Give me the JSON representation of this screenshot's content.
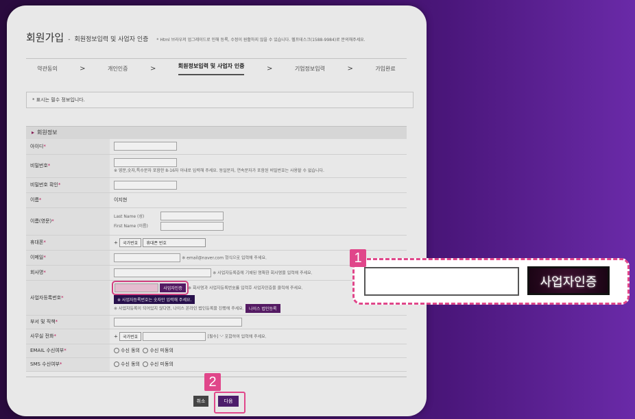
{
  "header": {
    "title": "회원가입",
    "dash": "-",
    "subtitle": "회원정보입력 및 사업자 인증",
    "note": "* Html 브라우저 업그레이드로 인해 등록, 수정이 원활하지 않을 수 있습니다. 헬프데스크(1588-9984)로 문의해주세요."
  },
  "steps": [
    {
      "label": "약관동의"
    },
    {
      "label": "개인인증"
    },
    {
      "label": "회원정보입력 및 사업자 인증"
    },
    {
      "label": "기업정보입력"
    },
    {
      "label": "가입완료"
    }
  ],
  "chevron": ">",
  "required_note": "* 표시는 필수 정보입니다.",
  "section_title": "회원정보",
  "fields": {
    "id": "아이디",
    "password": "비밀번호",
    "password_hint": "※ 영문,숫자,특수문자 포함한 8-16자 이내로 입력해 주세요. 동일문자, 연속문자가 포함된 비밀번호는 사용할 수 없습니다.",
    "password_confirm": "비밀번호 확인",
    "name": "이름",
    "name_value": "이지현",
    "name_en": "이름(영문)",
    "last_name": "Last Name (성)",
    "first_name": "First Name (이름)",
    "mobile": "휴대폰",
    "country_code": "국가번호",
    "mobile_number": "휴대폰 번호",
    "email": "이메일",
    "email_hint": "※ email@naver.com 형식으로 입력해 주세요.",
    "company": "회사명",
    "company_hint": "※ 사업자등록증에 기재된 명확한 회사명을 입력해 주세요.",
    "biz_no": "사업자등록번호",
    "biz_cert_small": "사업자인증",
    "biz_hint1": "※ 회사명과 사업자등록번호를 입력후 사업자인증을 클릭해 주세요.",
    "biz_hint2": "※ 사업자등록번호는 숫자만 입력해 주세요.",
    "biz_hint3": "※ 사업자등록이 되어있지 않다면, 나이스 온라인 법인등록을 진행해 주세요.",
    "nice_btn": "나이스 법인등록",
    "dept": "부서 및 직책",
    "office_phone": "사무실 전화",
    "office_hint": "[필수] '-' 포함하여 입력해 주세요.",
    "email_consent": "EMAIL 수신여부",
    "sms_consent": "SMS 수신여부",
    "agree": "수신 동의",
    "disagree": "수신 미동의"
  },
  "buttons": {
    "cancel": "취소",
    "next": "다음"
  },
  "callouts": {
    "badge1": "1",
    "badge2": "2",
    "zoom_button": "사업자인증"
  },
  "colors": {
    "highlight": "#e0468a",
    "button_dark": "#2a1150",
    "background": "#3a0f5a"
  }
}
